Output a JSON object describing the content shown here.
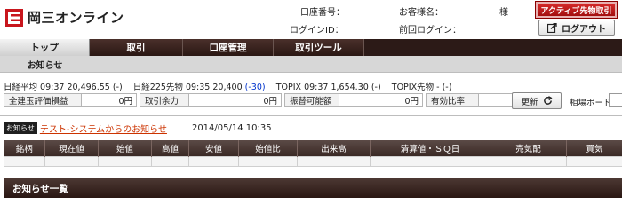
{
  "header": {
    "logo_text": "岡三オンライン",
    "account_no_label": "口座番号：",
    "customer_name_label": "お客様名：",
    "honorific": "様",
    "login_id_label": "ログインID：",
    "last_login_label": "前回ログイン：",
    "active_futures_button": "アクティブ先物取引",
    "logout_button": "ログアウト"
  },
  "nav": {
    "tabs": [
      {
        "label": "トップ",
        "active": true
      },
      {
        "label": "取引",
        "active": false
      },
      {
        "label": "口座管理",
        "active": false
      },
      {
        "label": "取引ツール",
        "active": false
      }
    ],
    "subtab": "お知らせ"
  },
  "ticker": {
    "n225_label": "日経平均",
    "n225_time": "09:37",
    "n225_value": "20,496.55",
    "n225_change": "(-)",
    "n225f_label": "日経225先物",
    "n225f_time": "09:35",
    "n225f_value": "20,400",
    "n225f_change": "(-30)",
    "topix_label": "TOPIX",
    "topix_time": "09:37",
    "topix_value": "1,654.30",
    "topix_change": "(-)",
    "topixf_label": "TOPIX先物",
    "topixf_value": "-",
    "topixf_change": "(-)"
  },
  "summary": {
    "items": [
      {
        "label": "全建玉評価損益",
        "value": "0円"
      },
      {
        "label": "取引余力",
        "value": "0円"
      },
      {
        "label": "振替可能額",
        "value": "0円"
      },
      {
        "label": "有効比率",
        "value": "-%"
      }
    ],
    "refresh_button": "更新",
    "board_label": "相場ボード"
  },
  "notice": {
    "badge": "お知らせ",
    "link_text": "テスト-システムからのお知らせ",
    "date": "2014/05/14 10:35"
  },
  "quote_table": {
    "headers": [
      "銘柄",
      "現在値",
      "始値",
      "高値",
      "安値",
      "始値比",
      "出来高",
      "清算値・ＳＱ日",
      "売気配",
      "買気"
    ]
  },
  "section": {
    "title": "お知らせ一覧"
  },
  "colors": {
    "nav_dark": "#2c1a17",
    "accent_red": "#c01818",
    "link_orange": "#cc3300",
    "negative_blue": "#0033cc"
  }
}
